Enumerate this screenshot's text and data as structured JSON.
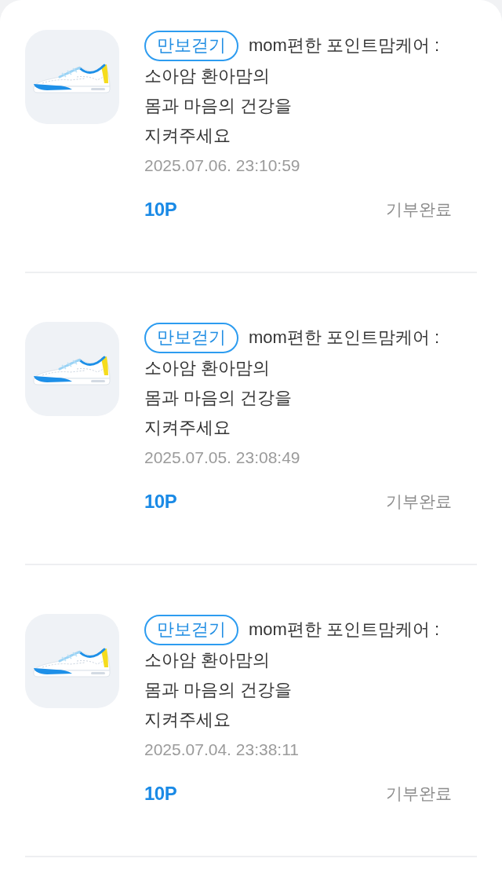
{
  "donations": [
    {
      "category": "만보걷기",
      "title_lines": [
        "mom편한 포인트맘케어 :",
        "소아암 환아맘의",
        "몸과 마음의 건강을",
        "지켜주세요"
      ],
      "date": "2025.07.06. 23:10:59",
      "points": "10P",
      "status": "기부완료"
    },
    {
      "category": "만보걷기",
      "title_lines": [
        "mom편한 포인트맘케어 :",
        "소아암 환아맘의",
        "몸과 마음의 건강을",
        "지켜주세요"
      ],
      "date": "2025.07.05. 23:08:49",
      "points": "10P",
      "status": "기부완료"
    },
    {
      "category": "만보걷기",
      "title_lines": [
        "mom편한 포인트맘케어 :",
        "소아암 환아맘의",
        "몸과 마음의 건강을",
        "지켜주세요"
      ],
      "date": "2025.07.04. 23:38:11",
      "points": "10P",
      "status": "기부완료"
    }
  ]
}
